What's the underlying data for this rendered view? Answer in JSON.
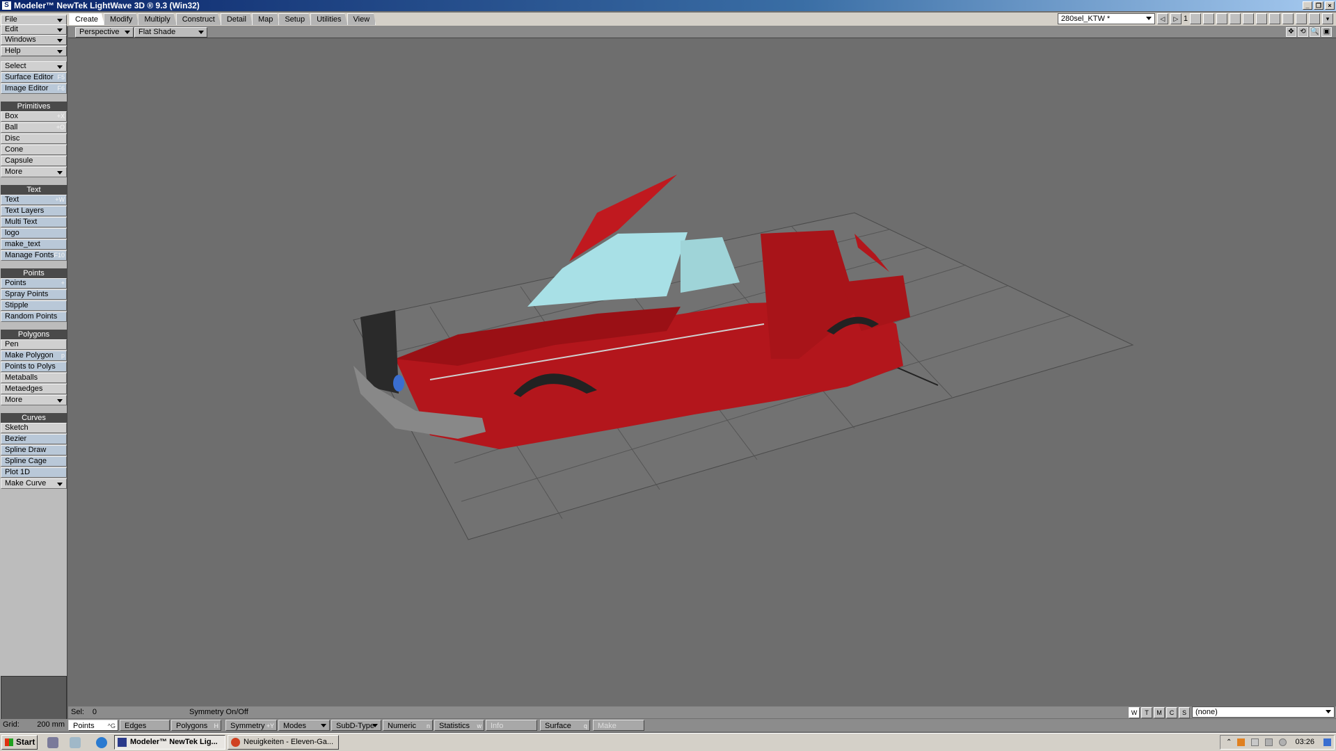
{
  "window": {
    "title": "Modeler™ NewTek LightWave 3D ® 9.3 (Win32)",
    "logo_glyph": "S",
    "min": "_",
    "max": "❐",
    "close": "×"
  },
  "menus": [
    "File",
    "Edit",
    "Windows",
    "Help"
  ],
  "tabs": [
    "Create",
    "Modify",
    "Multiply",
    "Construct",
    "Detail",
    "Map",
    "Setup",
    "Utilities",
    "View"
  ],
  "active_tab": "Create",
  "layer": {
    "scene": "280sel_KTW *",
    "number": "1"
  },
  "sidebar": {
    "select": "Select",
    "surface_editor": {
      "label": "Surface Editor",
      "shortcut": "F5"
    },
    "image_editor": {
      "label": "Image Editor",
      "shortcut": "F6"
    },
    "primitives_head": "Primitives",
    "primitives": [
      {
        "label": "Box",
        "shortcut": "+X"
      },
      {
        "label": "Ball",
        "shortcut": "+O"
      },
      {
        "label": "Disc",
        "shortcut": ""
      },
      {
        "label": "Cone",
        "shortcut": ""
      },
      {
        "label": "Capsule",
        "shortcut": ""
      },
      {
        "label": "More",
        "shortcut": ""
      }
    ],
    "text_head": "Text",
    "text": [
      {
        "label": "Text",
        "shortcut": "+W"
      },
      {
        "label": "Text Layers",
        "shortcut": ""
      },
      {
        "label": "Multi Text",
        "shortcut": ""
      },
      {
        "label": "logo",
        "shortcut": ""
      },
      {
        "label": "make_text",
        "shortcut": ""
      },
      {
        "label": "Manage Fonts",
        "shortcut": "F10"
      }
    ],
    "points_head": "Points",
    "points": [
      {
        "label": "Points",
        "shortcut": "+"
      },
      {
        "label": "Spray Points",
        "shortcut": ""
      },
      {
        "label": "Stipple",
        "shortcut": ""
      },
      {
        "label": "Random Points",
        "shortcut": ""
      }
    ],
    "polygons_head": "Polygons",
    "polygons": [
      {
        "label": "Pen",
        "shortcut": ""
      },
      {
        "label": "Make Polygon",
        "shortcut": "p"
      },
      {
        "label": "Points to Polys",
        "shortcut": ""
      },
      {
        "label": "Metaballs",
        "shortcut": ""
      },
      {
        "label": "Metaedges",
        "shortcut": ""
      },
      {
        "label": "More",
        "shortcut": ""
      }
    ],
    "curves_head": "Curves",
    "curves": [
      {
        "label": "Sketch",
        "shortcut": ""
      },
      {
        "label": "Bezier",
        "shortcut": ""
      },
      {
        "label": "Spline Draw",
        "shortcut": ""
      },
      {
        "label": "Spline Cage",
        "shortcut": ""
      },
      {
        "label": "Plot 1D",
        "shortcut": ""
      },
      {
        "label": "Make Curve",
        "shortcut": ""
      }
    ]
  },
  "viewport": {
    "view": "Perspective",
    "shading": "Flat Shade",
    "icons": [
      "✥",
      "⟲",
      "🔍",
      "▣"
    ]
  },
  "status": {
    "sel_label": "Sel:",
    "sel_value": "0",
    "hint": "Symmetry On/Off",
    "wtmcs": [
      "W",
      "T",
      "M",
      "C",
      "S"
    ],
    "vmap": "(none)"
  },
  "bottom": {
    "grid_label": "Grid:",
    "grid_value": "200 mm",
    "points": "Points",
    "points_sc": "^G",
    "edges": "Edges",
    "polygons": "Polygons",
    "polygons_sc": "H",
    "symmetry": "Symmetry",
    "symmetry_sc": "+Y",
    "modes": "Modes",
    "subd": "SubD-Type",
    "numeric": "Numeric",
    "numeric_sc": "n",
    "statistics": "Statistics",
    "statistics_sc": "w",
    "info": "Info",
    "surface": "Surface",
    "surface_sc": "q",
    "make": "Make"
  },
  "taskbar": {
    "start": "Start",
    "tasks": [
      "Modeler™ NewTek Lig...",
      "Neuigkeiten - Eleven-Ga..."
    ],
    "clock": "03:26"
  },
  "colors": {
    "car": "#b3161c",
    "glass": "#a8e0e6",
    "grid": "#555555"
  }
}
